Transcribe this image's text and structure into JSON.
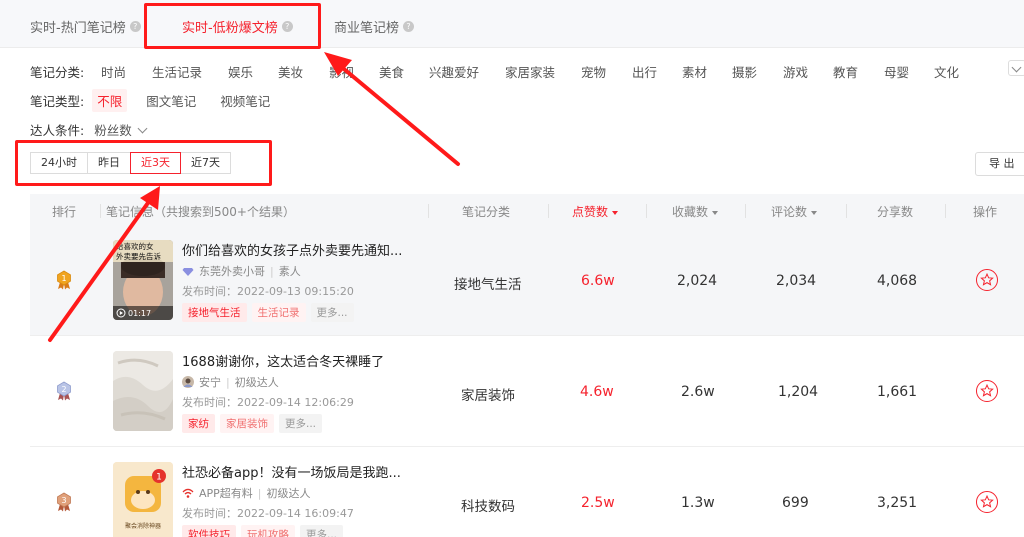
{
  "tabs": [
    {
      "label": "实时-热门笔记榜"
    },
    {
      "label": "实时-低粉爆文榜"
    },
    {
      "label": "商业笔记榜"
    }
  ],
  "filters": {
    "category_label": "笔记分类:",
    "categories": [
      "时尚",
      "生活记录",
      "娱乐",
      "美妆",
      "影视",
      "美食",
      "兴趣爱好",
      "家居家装",
      "宠物",
      "出行",
      "素材",
      "摄影",
      "游戏",
      "教育",
      "母婴",
      "文化"
    ],
    "type_label": "笔记类型:",
    "types": [
      "不限",
      "图文笔记",
      "视频笔记"
    ],
    "creator_label": "达人条件:",
    "creator_select": "粉丝数"
  },
  "time_buttons": [
    "24小时",
    "昨日",
    "近3天",
    "近7天"
  ],
  "export_label": "导 出",
  "table": {
    "headers": {
      "rank": "排行",
      "info": "笔记信息（共搜索到500+个结果）",
      "category": "笔记分类",
      "likes": "点赞数",
      "collects": "收藏数",
      "comments": "评论数",
      "shares": "分享数",
      "actions": "操作"
    },
    "rows": [
      {
        "rank": "1",
        "title": "你们给喜欢的女孩子点外卖要先通知...",
        "author": "东莞外卖小哥",
        "level": "素人",
        "published": "发布时间：2022-09-13 09:15:20",
        "thumb_lines": [
          "给喜欢的女",
          "外卖要先告诉"
        ],
        "duration": "01:17",
        "tags": [
          "接地气生活",
          "生活记录",
          "更多..."
        ],
        "category": "接地气生活",
        "likes": "6.6w",
        "collects": "2,024",
        "comments": "2,034",
        "shares": "4,068"
      },
      {
        "rank": "2",
        "title": "1688谢谢你，这太适合冬天裸睡了",
        "author": "安宁",
        "level": "初级达人",
        "published": "发布时间：2022-09-14 12:06:29",
        "tags": [
          "家纺",
          "家居装饰",
          "更多..."
        ],
        "category": "家居装饰",
        "likes": "4.6w",
        "collects": "2.6w",
        "comments": "1,204",
        "shares": "1,661"
      },
      {
        "rank": "3",
        "title": "社恐必备app！没有一场饭局是我跑...",
        "author": "APP超有料",
        "level": "初级达人",
        "published": "发布时间：2022-09-14 16:09:47",
        "thumb_badge": "1",
        "thumb_caption": "聚会消除神器",
        "tags": [
          "软件技巧",
          "玩机攻略",
          "更多..."
        ],
        "category": "科技数码",
        "likes": "2.5w",
        "collects": "1.3w",
        "comments": "699",
        "shares": "3,251"
      }
    ]
  },
  "colors": {
    "accent": "#f5222d",
    "annotation": "#ff1a1a"
  }
}
